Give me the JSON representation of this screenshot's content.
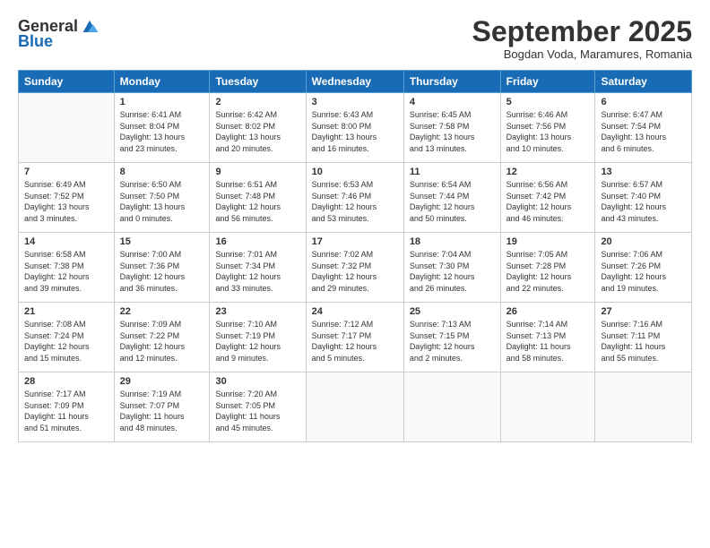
{
  "logo": {
    "general": "General",
    "blue": "Blue"
  },
  "title": "September 2025",
  "subtitle": "Bogdan Voda, Maramures, Romania",
  "headers": [
    "Sunday",
    "Monday",
    "Tuesday",
    "Wednesday",
    "Thursday",
    "Friday",
    "Saturday"
  ],
  "weeks": [
    [
      {
        "day": "",
        "info": ""
      },
      {
        "day": "1",
        "info": "Sunrise: 6:41 AM\nSunset: 8:04 PM\nDaylight: 13 hours\nand 23 minutes."
      },
      {
        "day": "2",
        "info": "Sunrise: 6:42 AM\nSunset: 8:02 PM\nDaylight: 13 hours\nand 20 minutes."
      },
      {
        "day": "3",
        "info": "Sunrise: 6:43 AM\nSunset: 8:00 PM\nDaylight: 13 hours\nand 16 minutes."
      },
      {
        "day": "4",
        "info": "Sunrise: 6:45 AM\nSunset: 7:58 PM\nDaylight: 13 hours\nand 13 minutes."
      },
      {
        "day": "5",
        "info": "Sunrise: 6:46 AM\nSunset: 7:56 PM\nDaylight: 13 hours\nand 10 minutes."
      },
      {
        "day": "6",
        "info": "Sunrise: 6:47 AM\nSunset: 7:54 PM\nDaylight: 13 hours\nand 6 minutes."
      }
    ],
    [
      {
        "day": "7",
        "info": "Sunrise: 6:49 AM\nSunset: 7:52 PM\nDaylight: 13 hours\nand 3 minutes."
      },
      {
        "day": "8",
        "info": "Sunrise: 6:50 AM\nSunset: 7:50 PM\nDaylight: 13 hours\nand 0 minutes."
      },
      {
        "day": "9",
        "info": "Sunrise: 6:51 AM\nSunset: 7:48 PM\nDaylight: 12 hours\nand 56 minutes."
      },
      {
        "day": "10",
        "info": "Sunrise: 6:53 AM\nSunset: 7:46 PM\nDaylight: 12 hours\nand 53 minutes."
      },
      {
        "day": "11",
        "info": "Sunrise: 6:54 AM\nSunset: 7:44 PM\nDaylight: 12 hours\nand 50 minutes."
      },
      {
        "day": "12",
        "info": "Sunrise: 6:56 AM\nSunset: 7:42 PM\nDaylight: 12 hours\nand 46 minutes."
      },
      {
        "day": "13",
        "info": "Sunrise: 6:57 AM\nSunset: 7:40 PM\nDaylight: 12 hours\nand 43 minutes."
      }
    ],
    [
      {
        "day": "14",
        "info": "Sunrise: 6:58 AM\nSunset: 7:38 PM\nDaylight: 12 hours\nand 39 minutes."
      },
      {
        "day": "15",
        "info": "Sunrise: 7:00 AM\nSunset: 7:36 PM\nDaylight: 12 hours\nand 36 minutes."
      },
      {
        "day": "16",
        "info": "Sunrise: 7:01 AM\nSunset: 7:34 PM\nDaylight: 12 hours\nand 33 minutes."
      },
      {
        "day": "17",
        "info": "Sunrise: 7:02 AM\nSunset: 7:32 PM\nDaylight: 12 hours\nand 29 minutes."
      },
      {
        "day": "18",
        "info": "Sunrise: 7:04 AM\nSunset: 7:30 PM\nDaylight: 12 hours\nand 26 minutes."
      },
      {
        "day": "19",
        "info": "Sunrise: 7:05 AM\nSunset: 7:28 PM\nDaylight: 12 hours\nand 22 minutes."
      },
      {
        "day": "20",
        "info": "Sunrise: 7:06 AM\nSunset: 7:26 PM\nDaylight: 12 hours\nand 19 minutes."
      }
    ],
    [
      {
        "day": "21",
        "info": "Sunrise: 7:08 AM\nSunset: 7:24 PM\nDaylight: 12 hours\nand 15 minutes."
      },
      {
        "day": "22",
        "info": "Sunrise: 7:09 AM\nSunset: 7:22 PM\nDaylight: 12 hours\nand 12 minutes."
      },
      {
        "day": "23",
        "info": "Sunrise: 7:10 AM\nSunset: 7:19 PM\nDaylight: 12 hours\nand 9 minutes."
      },
      {
        "day": "24",
        "info": "Sunrise: 7:12 AM\nSunset: 7:17 PM\nDaylight: 12 hours\nand 5 minutes."
      },
      {
        "day": "25",
        "info": "Sunrise: 7:13 AM\nSunset: 7:15 PM\nDaylight: 12 hours\nand 2 minutes."
      },
      {
        "day": "26",
        "info": "Sunrise: 7:14 AM\nSunset: 7:13 PM\nDaylight: 11 hours\nand 58 minutes."
      },
      {
        "day": "27",
        "info": "Sunrise: 7:16 AM\nSunset: 7:11 PM\nDaylight: 11 hours\nand 55 minutes."
      }
    ],
    [
      {
        "day": "28",
        "info": "Sunrise: 7:17 AM\nSunset: 7:09 PM\nDaylight: 11 hours\nand 51 minutes."
      },
      {
        "day": "29",
        "info": "Sunrise: 7:19 AM\nSunset: 7:07 PM\nDaylight: 11 hours\nand 48 minutes."
      },
      {
        "day": "30",
        "info": "Sunrise: 7:20 AM\nSunset: 7:05 PM\nDaylight: 11 hours\nand 45 minutes."
      },
      {
        "day": "",
        "info": ""
      },
      {
        "day": "",
        "info": ""
      },
      {
        "day": "",
        "info": ""
      },
      {
        "day": "",
        "info": ""
      }
    ]
  ]
}
